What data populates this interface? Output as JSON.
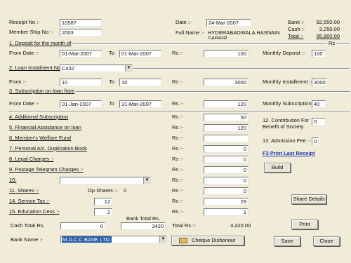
{
  "receipt": {
    "label": "Receipt No :-",
    "value": "10587"
  },
  "member": {
    "label": "Member Ship No :-",
    "value": "2003"
  },
  "date": {
    "label": "Date :-",
    "value": "24-Mar-2007"
  },
  "full_name": {
    "label": "Full Name :-",
    "value": "HYDERABADWALA HASNAIN",
    "value2": "SABBIR"
  },
  "balances": {
    "bank_label": "Bank :-",
    "bank_value": "92,550.00",
    "cash_label": "Cash :-",
    "cash_value": "3,250.00",
    "total_label": "Total :-",
    "total_value": "95,800.00"
  },
  "section1": {
    "title": "1. Deposit for the month of",
    "rs_header": "Rs",
    "from_label": "From Date :-",
    "from": "01-Mar-2007",
    "to_label": "To",
    "to": "01-Mar-2007",
    "rs_label": "Rs :-",
    "amount": "100",
    "monthly_label": "Monthly Deposit :-",
    "monthly": "100"
  },
  "section2": {
    "title": "2. Loan Instalment No",
    "loan_no": "C432",
    "from_label": "From :-",
    "from": "10",
    "to_label": "To",
    "to": "10",
    "rs_label": "Rs :-",
    "amount": "3000",
    "monthly_label": "Monthly Installment :-",
    "monthly": "3000"
  },
  "section3": {
    "title": "3. Subscription on loan from",
    "from_label": "From Date :-",
    "from": "01-Jan-2007",
    "to_label": "To",
    "to": "31-Mar-2007",
    "rs_label": "Rs :-",
    "amount": "120",
    "monthly_label": "Monthly Subscription :-",
    "monthly": "40"
  },
  "items": [
    {
      "label": "4. Additional Subscription",
      "rs": "Rs :-",
      "value": "50"
    },
    {
      "label": "5. Financial Assistance on loan",
      "rs": "Rs :-",
      "value": "120"
    },
    {
      "label": "6. Member's Welfare Fund",
      "rs": "Rs :-",
      "value": ""
    },
    {
      "label": "7. Personal A/c. Duplication Book",
      "rs": "Rs :-",
      "value": "0"
    },
    {
      "label": "8. Legal Charges :-",
      "rs": "Rs :-",
      "value": "0"
    },
    {
      "label": "9. Postage Telegram Charges :-",
      "rs": "Rs :-",
      "value": "0"
    },
    {
      "label": "10.",
      "rs": "Rs :-",
      "value": "0"
    },
    {
      "label": "11. Shares :-",
      "rs": "Rs :-",
      "value": "0"
    },
    {
      "label": "14. Service Tax :-",
      "rs": "Rs :-",
      "value": "29"
    },
    {
      "label": "15. Education Cess :-",
      "rs": "Rs :-",
      "value": "1"
    }
  ],
  "op_shares": {
    "label": "Op Shares :-",
    "value": "0"
  },
  "service_tax_rate": "12",
  "education_cess_rate": "2",
  "contribution": {
    "label1": "12. Contribution For",
    "label2": "Benefit of Society",
    "value": "0"
  },
  "admission": {
    "label": "13. Admission Fee :-",
    "value": "0"
  },
  "print_last": "F3 Print Last Receipt",
  "buttons": {
    "build": "Build",
    "share_details": "Share Details",
    "print": "Print",
    "cheque": "Cheque Dishonour",
    "save": "Save",
    "close": "Close"
  },
  "cash_total": {
    "label": "Cash Total Rs.",
    "value": "0"
  },
  "bank_total": {
    "label": "Bank Total Rs.",
    "value": "3420"
  },
  "total_rs": {
    "label": "Total Rs :-",
    "value": "3,420.00"
  },
  "bank_name": {
    "label": "Bank Name :-",
    "value": "M.D.C.C BANK LTD."
  }
}
